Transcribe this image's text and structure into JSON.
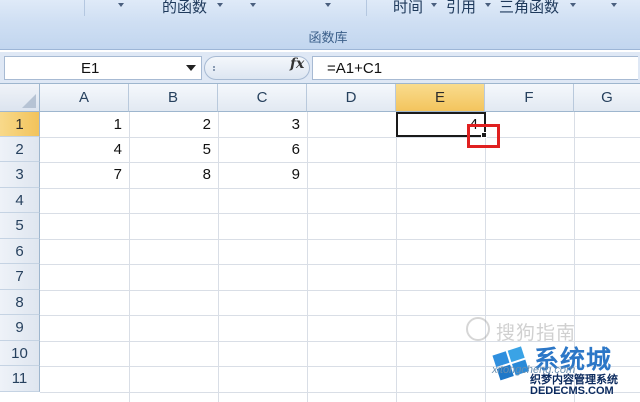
{
  "ribbon": {
    "items": [
      {
        "label": "的函数"
      },
      {
        "label": "时间"
      },
      {
        "label": "引用"
      },
      {
        "label": "三角函数"
      }
    ],
    "group_label": "函数库"
  },
  "formula_bar": {
    "name_box": "E1",
    "fx_icon": "fx",
    "formula": "=A1+C1"
  },
  "grid": {
    "columns": [
      "A",
      "B",
      "C",
      "D",
      "E",
      "F",
      "G"
    ],
    "rows": [
      "1",
      "2",
      "3",
      "4",
      "5",
      "6",
      "7",
      "8",
      "9",
      "10",
      "11"
    ],
    "active_cell": "E1",
    "cells": [
      [
        "1",
        "2",
        "3",
        "",
        "4",
        "",
        ""
      ],
      [
        "4",
        "5",
        "6",
        "",
        "",
        "",
        ""
      ],
      [
        "7",
        "8",
        "9",
        "",
        "",
        "",
        ""
      ]
    ]
  },
  "watermark": {
    "sogou": "搜狗指南",
    "brand": "系统城",
    "url": "xitongcheng.com",
    "sub": "织梦内容管理系统",
    "domain": "DEDECMS.COM"
  },
  "colors": {
    "highlight": "#e02020",
    "active_header": "#f3c45d",
    "ribbon": "#cfdff3"
  }
}
